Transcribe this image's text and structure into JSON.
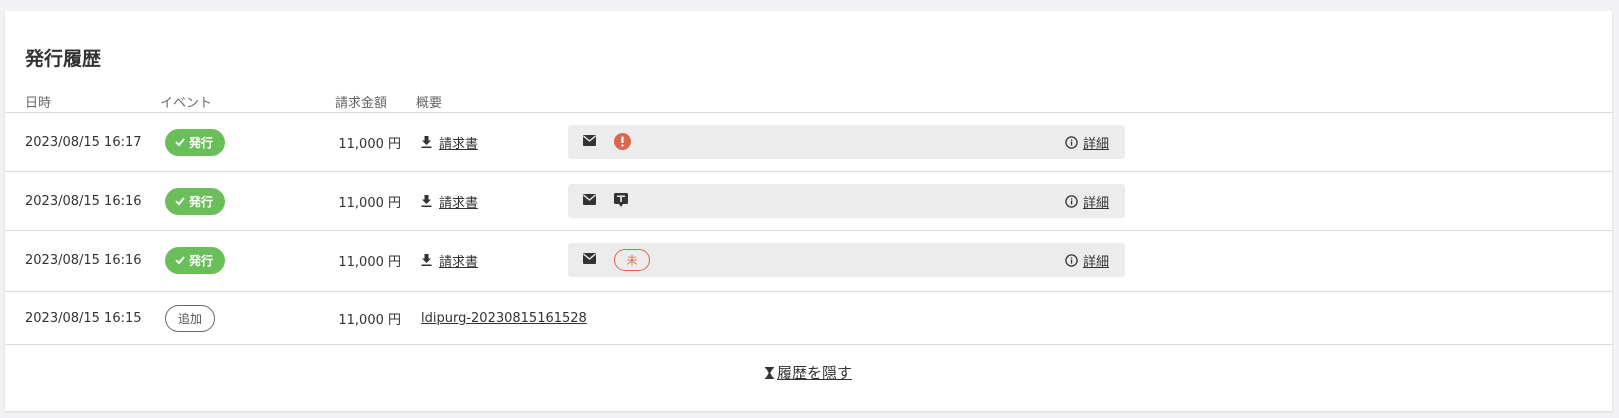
{
  "title": "発行履歴",
  "columns": {
    "date": "日時",
    "event": "イベント",
    "amount": "請求金額",
    "summary": "概要"
  },
  "rows": [
    {
      "date": "2023/08/15 16:17",
      "event": "発行",
      "amount": "11,000 円",
      "summary": "請求書",
      "status": "error",
      "detail": "詳細"
    },
    {
      "date": "2023/08/15 16:16",
      "event": "発行",
      "amount": "11,000 円",
      "summary": "請求書",
      "status": "message",
      "detail": "詳細"
    },
    {
      "date": "2023/08/15 16:16",
      "event": "発行",
      "amount": "11,000 円",
      "summary": "請求書",
      "status": "unread",
      "status_label": "未",
      "detail": "詳細"
    },
    {
      "date": "2023/08/15 16:15",
      "event": "追加",
      "amount": "11,000 円",
      "summary": "ldipurg-20230815161528"
    }
  ],
  "hide_label": "履歴を隠す",
  "colors": {
    "issue_badge": "#6abf5a",
    "error": "#d9694e",
    "panel": "#ececec"
  }
}
